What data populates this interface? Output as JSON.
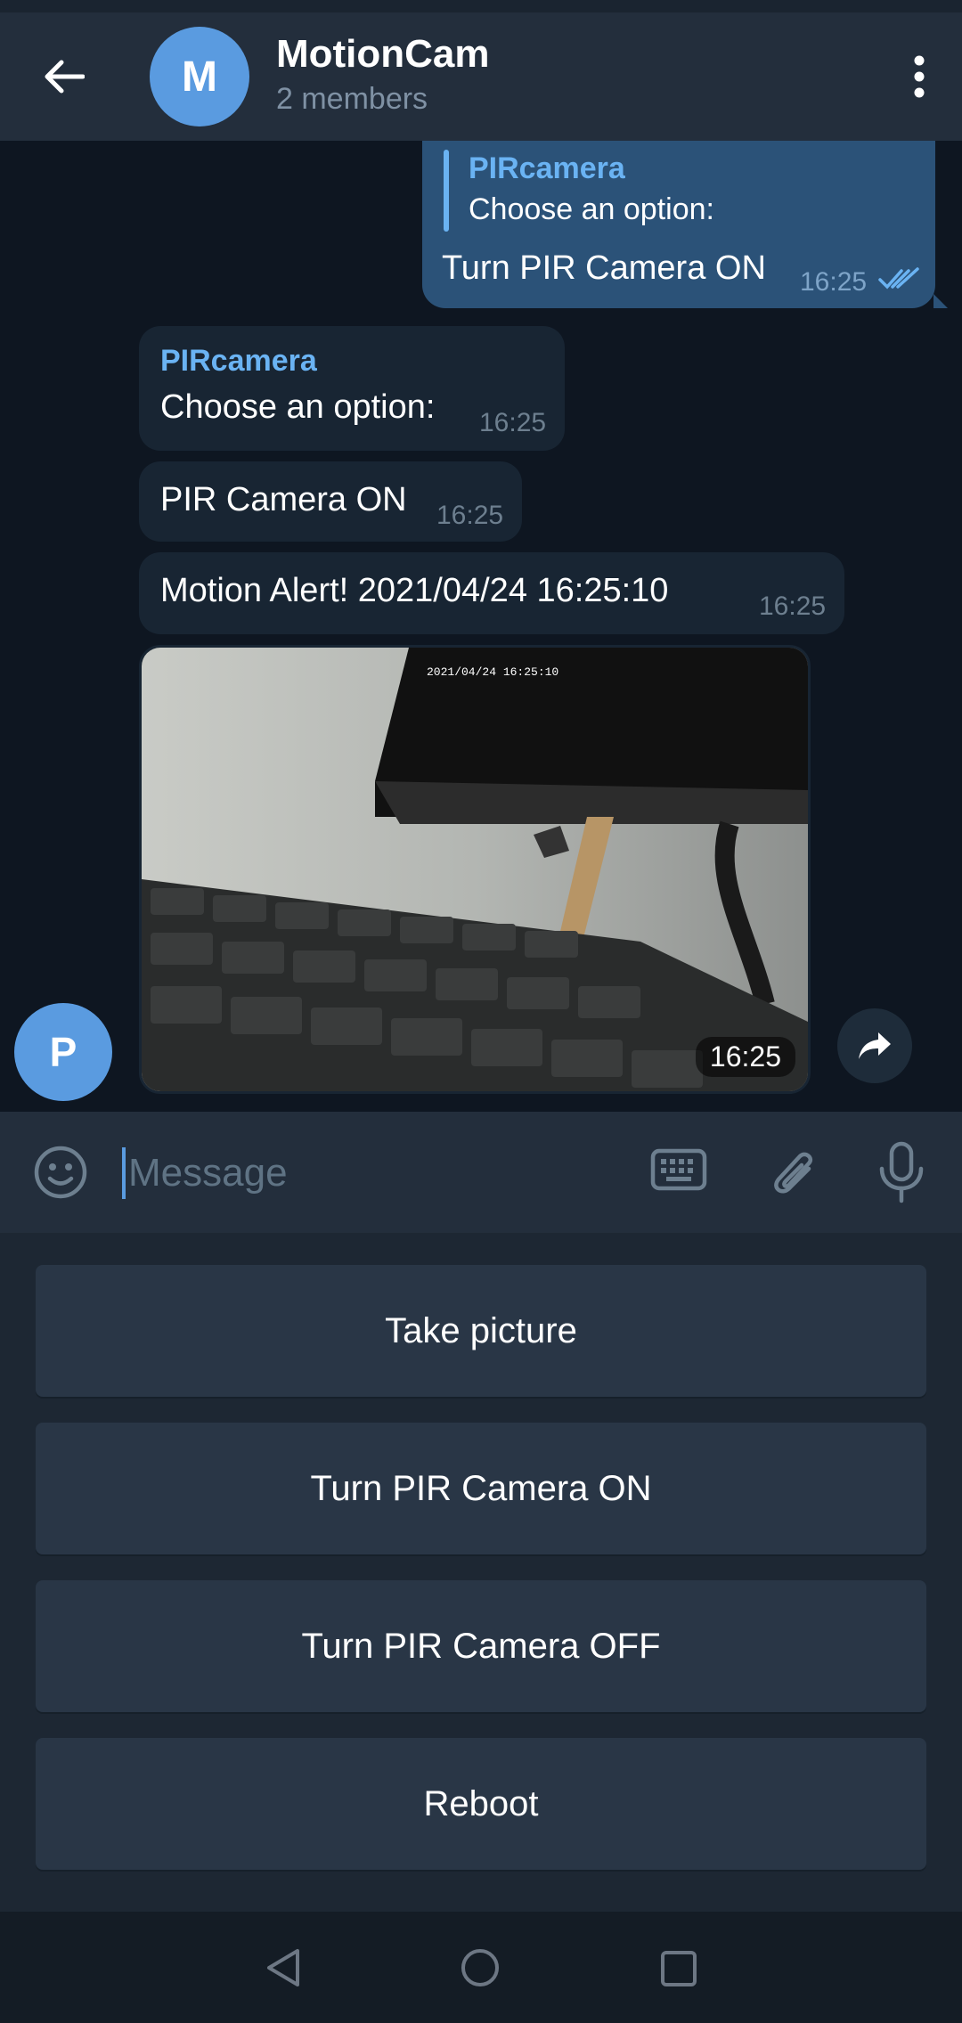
{
  "header": {
    "title": "MotionCam",
    "subtitle": "2 members",
    "avatar_letter": "M"
  },
  "messages": {
    "outgoing": {
      "reply_name": "PIRcamera",
      "reply_text": "Choose an option:",
      "text": "Turn PIR Camera ON",
      "time": "16:25"
    },
    "incoming_1": {
      "sender": "PIRcamera",
      "text": "Choose an option:",
      "time": "16:25"
    },
    "incoming_2": {
      "text": "PIR Camera ON",
      "time": "16:25"
    },
    "incoming_3": {
      "text": "Motion Alert! 2021/04/24 16:25:10",
      "time": "16:25"
    },
    "photo": {
      "timestamp_overlay": "2021/04/24  16:25:10",
      "time": "16:25"
    },
    "sender_avatar_letter": "P"
  },
  "composer": {
    "placeholder": "Message"
  },
  "keyboard": {
    "buttons": [
      "Take picture",
      "Turn PIR Camera ON",
      "Turn PIR Camera OFF",
      "Reboot"
    ]
  },
  "colors": {
    "header_bg": "#232e3c",
    "chat_bg": "#0e1621",
    "outgoing_bubble": "#2b5278",
    "incoming_bubble": "#182533",
    "accent": "#6ab3f3",
    "avatar": "#5a9be0"
  },
  "icons": {
    "back": "arrow-left-icon",
    "menu": "more-vertical-icon",
    "emoji": "smile-icon",
    "keyboard": "keyboard-icon",
    "attach": "paperclip-icon",
    "mic": "microphone-icon",
    "share": "share-arrow-icon",
    "read": "double-check-icon"
  }
}
